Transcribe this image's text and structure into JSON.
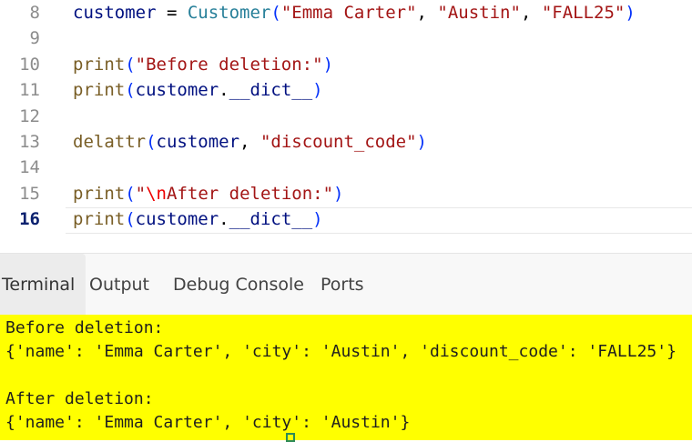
{
  "editor": {
    "active_line": "16",
    "lines": [
      {
        "num": "8",
        "tokens": [
          {
            "t": "customer",
            "c": "t-var"
          },
          {
            "t": " = ",
            "c": "t-pun"
          },
          {
            "t": "Customer",
            "c": "t-cls"
          },
          {
            "t": "(",
            "c": "t-par"
          },
          {
            "t": "\"Emma Carter\"",
            "c": "t-str"
          },
          {
            "t": ", ",
            "c": "t-pun"
          },
          {
            "t": "\"Austin\"",
            "c": "t-str"
          },
          {
            "t": ", ",
            "c": "t-pun"
          },
          {
            "t": "\"FALL25\"",
            "c": "t-str"
          },
          {
            "t": ")",
            "c": "t-par"
          }
        ]
      },
      {
        "num": "9",
        "tokens": []
      },
      {
        "num": "10",
        "tokens": [
          {
            "t": "print",
            "c": "t-fn"
          },
          {
            "t": "(",
            "c": "t-par"
          },
          {
            "t": "\"Before deletion:\"",
            "c": "t-str"
          },
          {
            "t": ")",
            "c": "t-par"
          }
        ]
      },
      {
        "num": "11",
        "tokens": [
          {
            "t": "print",
            "c": "t-fn"
          },
          {
            "t": "(",
            "c": "t-par"
          },
          {
            "t": "customer",
            "c": "t-var"
          },
          {
            "t": ".",
            "c": "t-pun"
          },
          {
            "t": "__dict__",
            "c": "t-var"
          },
          {
            "t": ")",
            "c": "t-par"
          }
        ]
      },
      {
        "num": "12",
        "tokens": []
      },
      {
        "num": "13",
        "tokens": [
          {
            "t": "delattr",
            "c": "t-fn"
          },
          {
            "t": "(",
            "c": "t-par"
          },
          {
            "t": "customer",
            "c": "t-var"
          },
          {
            "t": ", ",
            "c": "t-pun"
          },
          {
            "t": "\"discount_code\"",
            "c": "t-str"
          },
          {
            "t": ")",
            "c": "t-par"
          }
        ]
      },
      {
        "num": "14",
        "tokens": []
      },
      {
        "num": "15",
        "tokens": [
          {
            "t": "print",
            "c": "t-fn"
          },
          {
            "t": "(",
            "c": "t-par"
          },
          {
            "t": "\"",
            "c": "t-str"
          },
          {
            "t": "\\n",
            "c": "t-esc"
          },
          {
            "t": "After deletion:\"",
            "c": "t-str"
          },
          {
            "t": ")",
            "c": "t-par"
          }
        ]
      },
      {
        "num": "16",
        "tokens": [
          {
            "t": "print",
            "c": "t-fn"
          },
          {
            "t": "(",
            "c": "t-par"
          },
          {
            "t": "customer",
            "c": "t-var"
          },
          {
            "t": ".",
            "c": "t-pun"
          },
          {
            "t": "__dict__",
            "c": "t-var"
          },
          {
            "t": ")",
            "c": "t-par"
          }
        ]
      }
    ]
  },
  "panel": {
    "tabs": [
      {
        "label": "Terminal",
        "active": true
      },
      {
        "label": "Output",
        "active": false
      },
      {
        "label": "Debug Console",
        "active": false
      },
      {
        "label": "Ports",
        "active": false
      }
    ]
  },
  "terminal": {
    "lines": [
      "Before deletion:",
      "{'name': 'Emma Carter', 'city': 'Austin', 'discount_code': 'FALL25'}",
      "",
      "After deletion:",
      "{'name': 'Emma Carter', 'city': 'Austin'}"
    ],
    "highlight_color": "#ffff00"
  }
}
